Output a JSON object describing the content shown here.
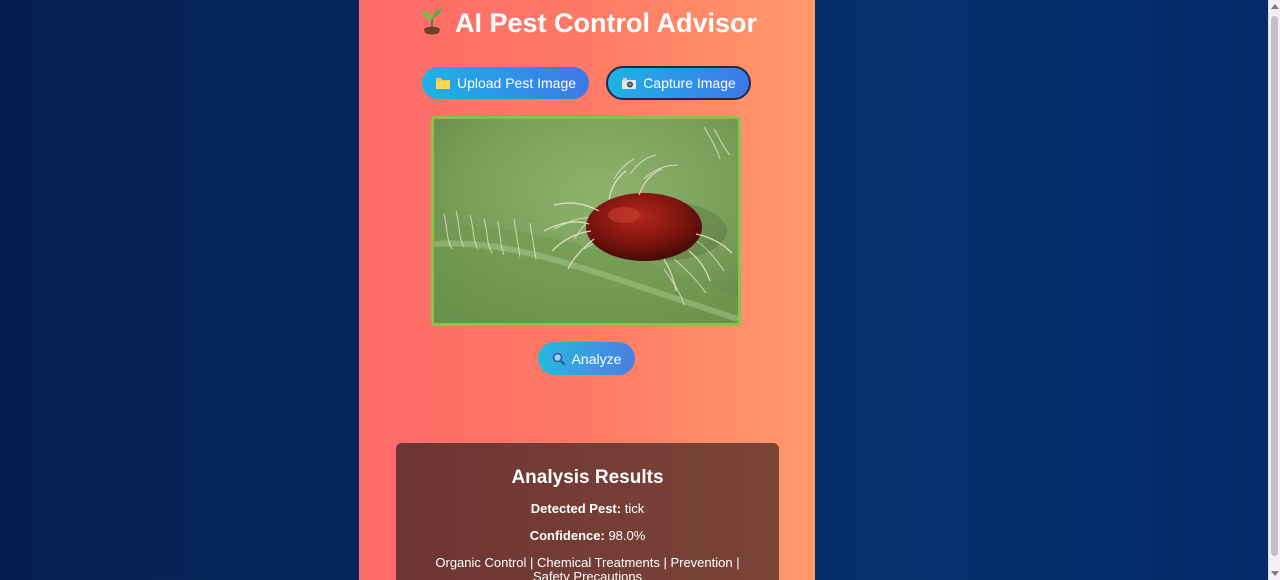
{
  "app": {
    "title": "AI Pest Control Advisor",
    "title_icon": "sprout-icon"
  },
  "actions": {
    "upload_label": "Upload Pest Image",
    "upload_icon": "folder-icon",
    "capture_label": "Capture Image",
    "capture_icon": "camera-icon",
    "analyze_label": "Analyze",
    "analyze_icon": "magnifier-icon"
  },
  "results": {
    "title": "Analysis Results",
    "detected_label": "Detected Pest:",
    "detected_value": "tick",
    "confidence_label": "Confidence:",
    "confidence_value": "98.0%",
    "sections": "Organic Control | Chemical Treatments | Prevention | Safety Precautions"
  },
  "colors": {
    "page_bg": "#042a63",
    "panel_gradient_start": "#ff6a6a",
    "panel_gradient_end": "#ff9a6a",
    "button_gradient_start": "#1fb1e6",
    "button_gradient_end": "#3e77e8",
    "preview_border": "#8bc34a",
    "results_bg": "#6d3533"
  }
}
